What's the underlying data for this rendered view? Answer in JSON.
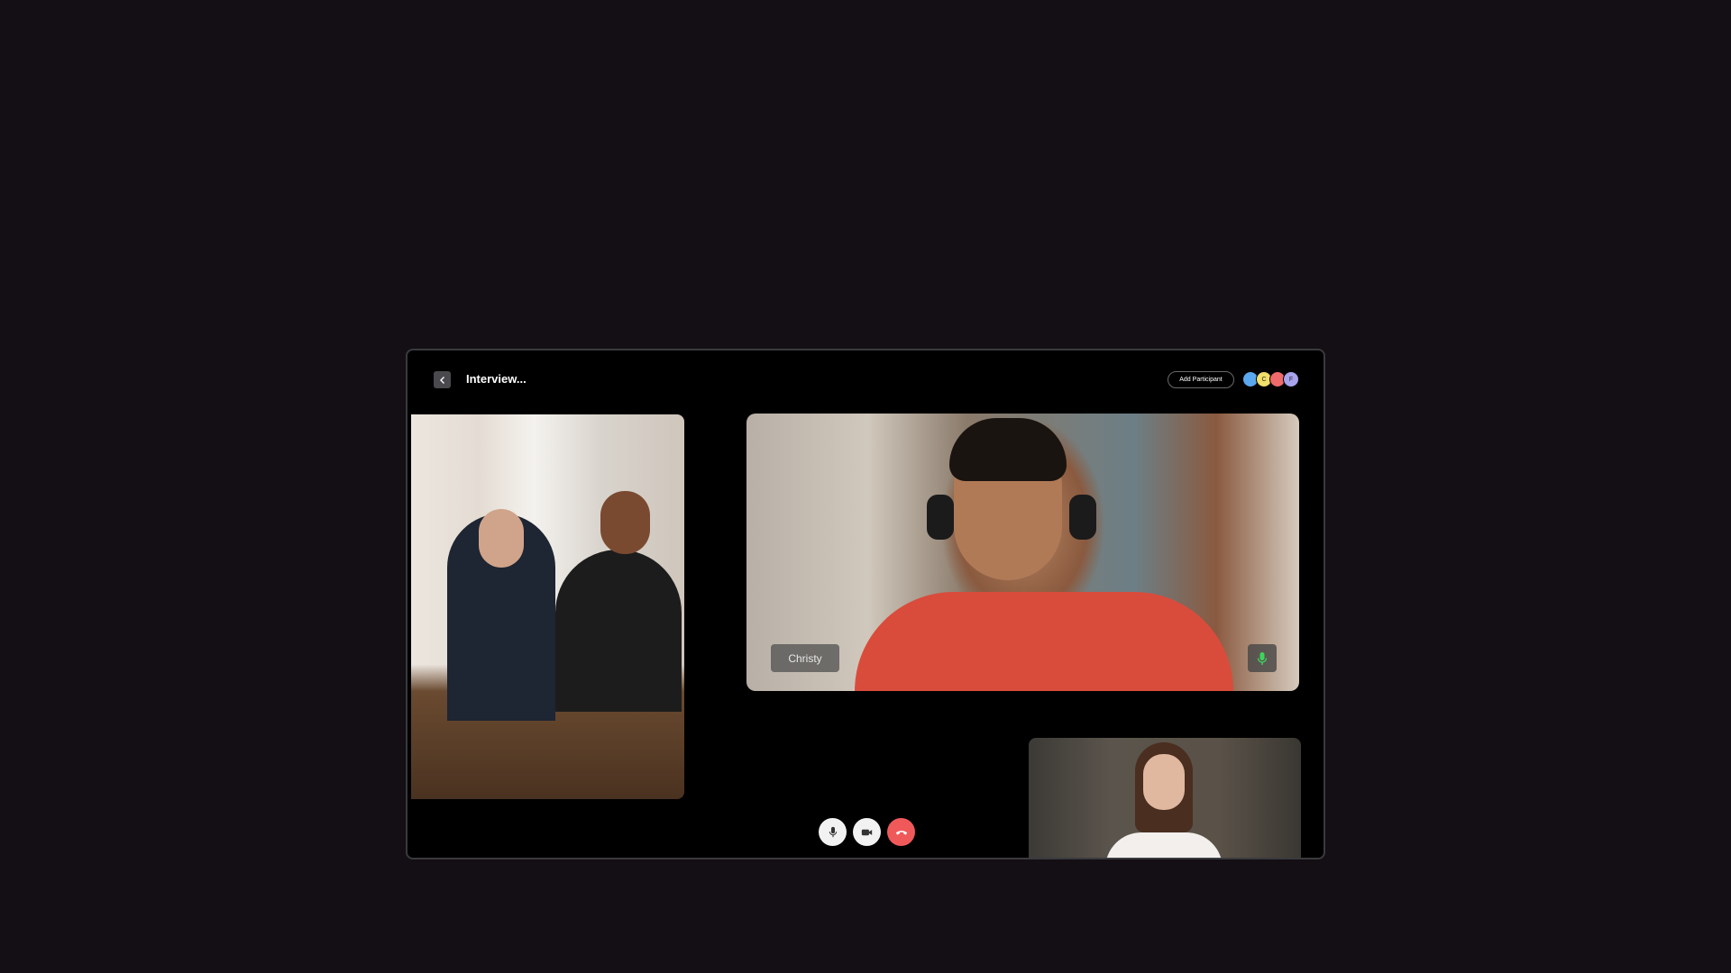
{
  "header": {
    "back_icon": "chevron-left-icon",
    "title": "Interview...",
    "add_participant_label": "Add Participant",
    "avatars": [
      {
        "initial": "",
        "color": "#5aa8ef"
      },
      {
        "initial": "C",
        "color": "#f2df6a"
      },
      {
        "initial": "",
        "color": "#ef6a6a"
      },
      {
        "initial": "F",
        "color": "#a8a3ee"
      }
    ]
  },
  "main_video": {
    "name": "Christy",
    "mic_icon": "microphone-icon",
    "mic_color": "#3dd45a"
  },
  "controls": {
    "mic_icon": "microphone-icon",
    "camera_icon": "video-camera-icon",
    "end_call_icon": "phone-hangup-icon",
    "end_call_color": "#f0595a"
  },
  "colors": {
    "page_background": "#140f14",
    "window_background": "#000000"
  }
}
